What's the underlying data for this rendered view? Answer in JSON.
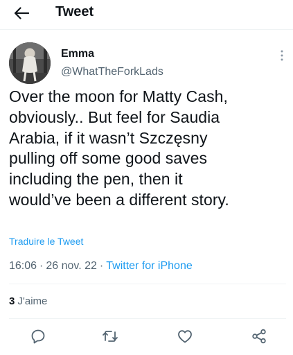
{
  "header": {
    "title": "Tweet",
    "back_icon": "arrow-left-icon"
  },
  "tweet": {
    "author_name": "Emma",
    "author_handle": "@WhatTheForkLads",
    "text": "Over the moon for Matty Cash,\nobviously.. But feel for Saudia\nArabia, if it wasn’t Szczęsny\npulling off some good saves\nincluding the pen, then it\nwould’ve been a different story.",
    "translate_label": "Traduire le Tweet",
    "time": "16:06",
    "date": "26 nov. 22",
    "separator": "·",
    "source": "Twitter for iPhone",
    "likes_count": "3",
    "likes_label": "J'aime"
  },
  "actions": [
    {
      "name": "reply",
      "icon": "reply-icon"
    },
    {
      "name": "retweet",
      "icon": "retweet-icon"
    },
    {
      "name": "like",
      "icon": "heart-icon"
    },
    {
      "name": "share",
      "icon": "share-icon"
    }
  ],
  "colors": {
    "text": "#0f1419",
    "secondary": "#536471",
    "accent": "#1d9bf0",
    "divider": "#eff3f4"
  }
}
